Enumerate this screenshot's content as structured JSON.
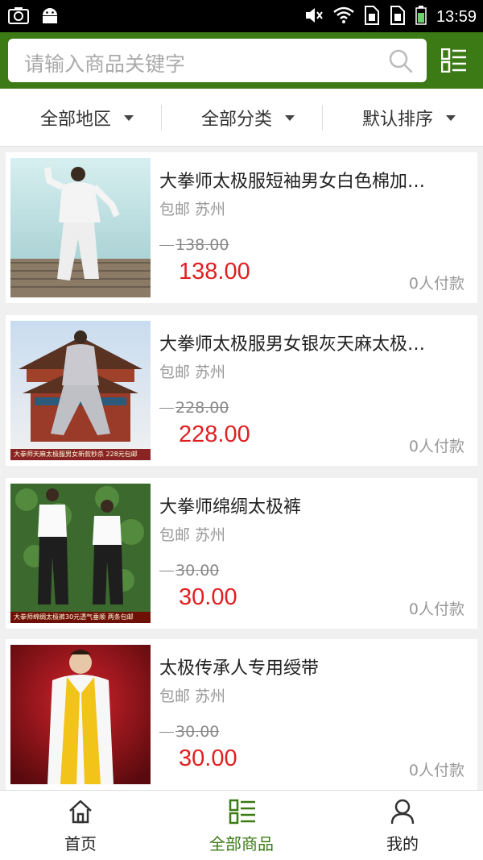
{
  "status_bar": {
    "time": "13:59",
    "icons": [
      "screenshot-icon",
      "android-icon",
      "mute-icon",
      "wifi-icon",
      "sim-icon",
      "sim-icon",
      "battery-icon"
    ]
  },
  "search": {
    "placeholder": "请输入商品关键字"
  },
  "filters": [
    {
      "label": "全部地区"
    },
    {
      "label": "全部分类"
    },
    {
      "label": "默认排序"
    }
  ],
  "products": [
    {
      "title": "大拳师太极服短袖男女白色棉加…",
      "shipping": "包邮",
      "location": "苏州",
      "original_price": "138.00",
      "price": "138.00",
      "paid": "0人付款"
    },
    {
      "title": "大拳师太极服男女银灰天麻太极…",
      "shipping": "包邮",
      "location": "苏州",
      "original_price": "228.00",
      "price": "228.00",
      "paid": "0人付款",
      "caption": "大拳师天麻太极服男女新款秒杀 228元包邮"
    },
    {
      "title": "大拳师绵绸太极裤",
      "shipping": "包邮",
      "location": "苏州",
      "original_price": "30.00",
      "price": "30.00",
      "paid": "0人付款",
      "caption": "大拳师绵绸太极裤30元透气垂顺 两条包邮"
    },
    {
      "title": "太极传承人专用绶带",
      "shipping": "包邮",
      "location": "苏州",
      "original_price": "30.00",
      "price": "30.00",
      "paid": "0人付款"
    }
  ],
  "bottom_nav": [
    {
      "label": "首页",
      "icon": "home-icon"
    },
    {
      "label": "全部商品",
      "icon": "list-icon"
    },
    {
      "label": "我的",
      "icon": "user-icon"
    }
  ],
  "colors": {
    "brand_green": "#3b7a14",
    "price_red": "#e02020"
  }
}
